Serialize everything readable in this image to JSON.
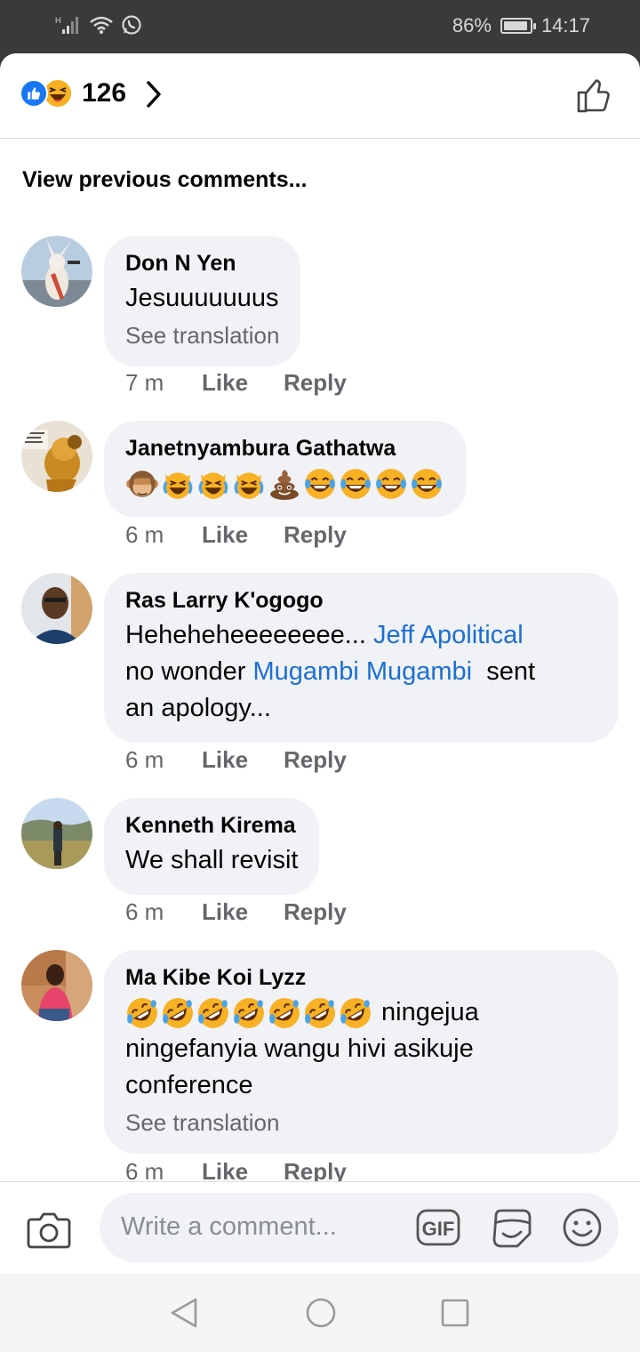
{
  "status": {
    "battery": "86%",
    "time": "14:17",
    "battery_level": 0.86
  },
  "header": {
    "reaction_count": "126",
    "reaction_icons": [
      "like-icon",
      "haha-icon"
    ]
  },
  "view_previous": "View previous comments...",
  "comments": [
    {
      "author": "Don N Yen",
      "text": "Jesuuuuuuus",
      "see_translation": "See translation",
      "time": "7 m",
      "like": "Like",
      "reply": "Reply"
    },
    {
      "author": "Janetnyambura Gathatwa",
      "emojis": [
        "monkey",
        "cat",
        "cat",
        "cat",
        "poop",
        "joy",
        "joy",
        "joy",
        "joy"
      ],
      "time": "6 m",
      "like": "Like",
      "reply": "Reply"
    },
    {
      "author": "Ras Larry K'ogogo",
      "text_1": "Heheheheeeeeeee... ",
      "mention_1": "Jeff Apolitical",
      "text_2": "no wonder ",
      "mention_2": "Mugambi Mugambi",
      "text_3": "  sent",
      "text_4": "an apology...",
      "time": "6 m",
      "like": "Like",
      "reply": "Reply"
    },
    {
      "author": "Kenneth Kirema",
      "text": "We shall revisit",
      "time": "6 m",
      "like": "Like",
      "reply": "Reply"
    },
    {
      "author": "Ma Kibe Koi Lyzz",
      "emojis": [
        "rofl",
        "rofl",
        "rofl",
        "rofl",
        "rofl",
        "rofl",
        "rofl"
      ],
      "text_1": " ningejua",
      "text_2": "ningefanyia wangu hivi asikuje",
      "text_3": "conference",
      "see_translation": "See translation",
      "time": "6 m",
      "like": "Like",
      "reply": "Reply"
    }
  ],
  "composer": {
    "placeholder": "Write a comment...",
    "gif_label": "GIF"
  },
  "colors": {
    "accent": "#1877f2",
    "mention": "#1d6fd2",
    "bubble": "#f0f2f5",
    "muted": "#65676b"
  }
}
